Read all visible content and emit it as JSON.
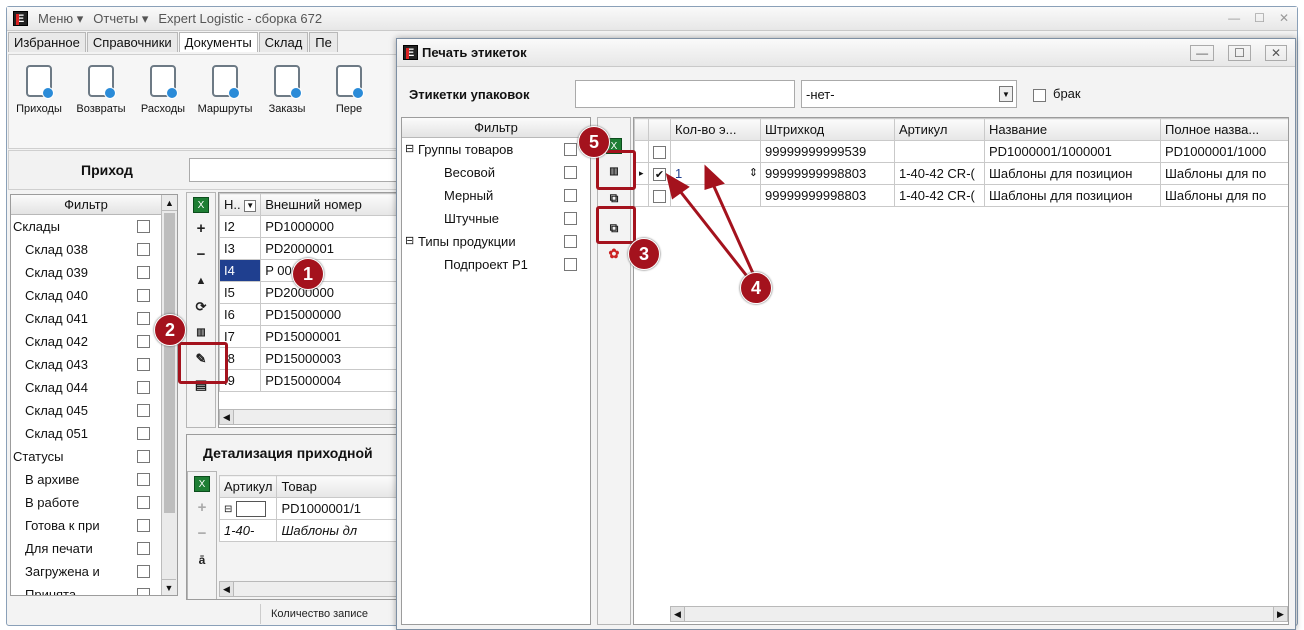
{
  "back_window": {
    "menu_label": "Меню",
    "reports_label": "Отчеты",
    "title": "Expert Logistic - сборка 672",
    "tabs": [
      "Избранное",
      "Справочники",
      "Документы",
      "Склад",
      "Пе"
    ],
    "ribbon": [
      "Приходы",
      "Возвраты",
      "Расходы",
      "Маршруты",
      "Заказы",
      "Пере"
    ],
    "section_title": "Приход",
    "filter_header": "Фильтр",
    "filter_items": [
      "Склады",
      "Склад 038",
      "Склад 039",
      "Склад 040",
      "Склад 041",
      "Склад 042",
      "Склад 043",
      "Склад 044",
      "Склад 045",
      "Склад 051",
      "Статусы",
      "В архиве",
      "В работе",
      "Готова к при",
      "Для печати",
      "Загружена и",
      "Принята"
    ],
    "grid_headers": [
      "Н..",
      "Внешний номер"
    ],
    "grid_rows": [
      {
        "n": "I2",
        "ext": "PD1000000"
      },
      {
        "n": "I3",
        "ext": "PD2000001"
      },
      {
        "n": "I4",
        "ext": "P   00001"
      },
      {
        "n": "I5",
        "ext": "PD2000000"
      },
      {
        "n": "I6",
        "ext": "PD15000000"
      },
      {
        "n": "I7",
        "ext": "PD15000001"
      },
      {
        "n": "I8",
        "ext": "PD15000003"
      },
      {
        "n": "I9",
        "ext": "PD15000004"
      }
    ],
    "detail_title": "Детализация приходной",
    "detail_headers": [
      "Артикул",
      "Товар"
    ],
    "detail_rows": [
      {
        "art": "",
        "item": "PD1000001/1"
      },
      {
        "art": "1-40-",
        "item": "Шаблоны дл"
      }
    ],
    "status_text": "Количество записе"
  },
  "front_window": {
    "title": "Печать этикеток",
    "label_packaging": "Этикетки упаковок",
    "select_value": "-нет-",
    "defect_label": "брак",
    "filter_header": "Фильтр",
    "filter_items": [
      "Группы товаров",
      "Весовой",
      "Мерный",
      "Штучные",
      "Типы продукции",
      "Подпроект P1"
    ],
    "grid_headers": [
      "Кол-во э...",
      "Штрихкод",
      "Артикул",
      "Название",
      "Полное назва..."
    ],
    "grid_rows": [
      {
        "checked": false,
        "qty": "",
        "barcode": "99999999999539",
        "article": "",
        "name": "PD1000001/1000001",
        "full": "PD1000001/1000"
      },
      {
        "checked": true,
        "qty": "1",
        "barcode": "99999999998803",
        "article": "1-40-42 CR-(",
        "name": "Шаблоны для позицион",
        "full": "Шаблоны для по"
      },
      {
        "checked": false,
        "qty": "",
        "barcode": "99999999998803",
        "article": "1-40-42 CR-(",
        "name": "Шаблоны для позицион",
        "full": "Шаблоны для по"
      }
    ]
  },
  "badges": [
    "1",
    "2",
    "3",
    "4",
    "5"
  ],
  "colors": {
    "accent_red": "#a4121d",
    "selection": "#1f3f8f"
  }
}
